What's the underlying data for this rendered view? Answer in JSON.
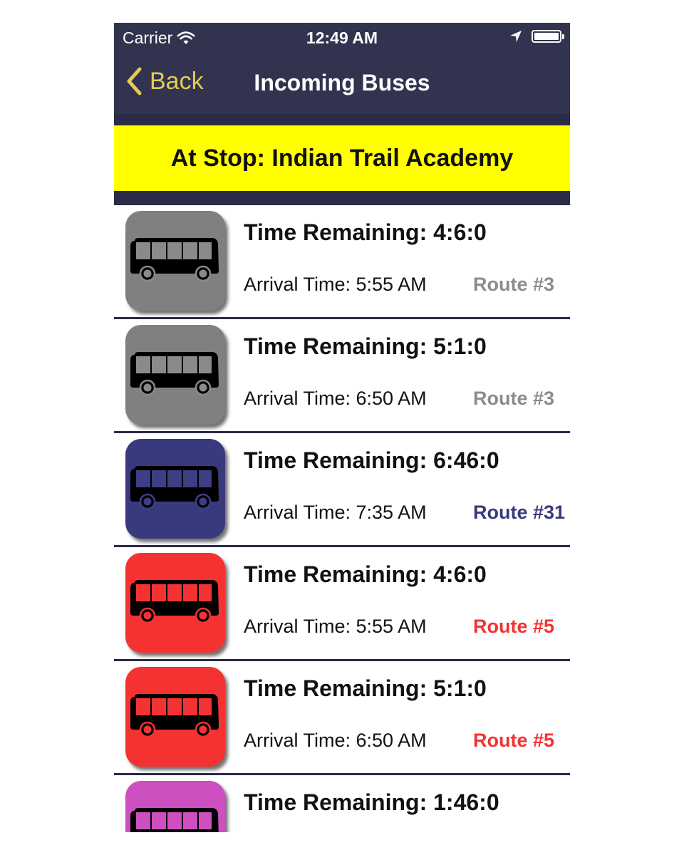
{
  "status_bar": {
    "carrier": "Carrier",
    "time": "12:49 AM",
    "icons": [
      "wifi-icon",
      "location-arrow-icon",
      "battery-icon"
    ]
  },
  "nav": {
    "back_label": "Back",
    "title": "Incoming Buses",
    "accent_color": "#e2cc55",
    "background_color": "#32334f"
  },
  "banner": {
    "text": "At Stop: Indian Trail Academy",
    "background_color": "#ffff00"
  },
  "buses": [
    {
      "remaining": "Time Remaining: 4:6:0",
      "arrival": "Arrival Time: 5:55 AM",
      "route": "Route #3",
      "tile_color": "#808080",
      "window_color": "#8a8a8a",
      "route_color": "#8c8c8c"
    },
    {
      "remaining": "Time Remaining: 5:1:0",
      "arrival": "Arrival Time: 6:50 AM",
      "route": "Route #3",
      "tile_color": "#808080",
      "window_color": "#8a8a8a",
      "route_color": "#8c8c8c"
    },
    {
      "remaining": "Time Remaining: 6:46:0",
      "arrival": "Arrival Time: 7:35 AM",
      "route": "Route #31",
      "tile_color": "#393a7e",
      "window_color": "#3d3e86",
      "route_color": "#393a7e"
    },
    {
      "remaining": "Time Remaining: 4:6:0",
      "arrival": "Arrival Time: 5:55 AM",
      "route": "Route #5",
      "tile_color": "#f43232",
      "window_color": "#f43232",
      "route_color": "#f43232"
    },
    {
      "remaining": "Time Remaining: 5:1:0",
      "arrival": "Arrival Time: 6:50 AM",
      "route": "Route #5",
      "tile_color": "#f43232",
      "window_color": "#f43232",
      "route_color": "#f43232"
    },
    {
      "remaining": "Time Remaining: 1:46:0",
      "arrival": "",
      "route": "",
      "tile_color": "#cd4fc0",
      "window_color": "#cd4fc0",
      "route_color": "#cd4fc0"
    }
  ]
}
